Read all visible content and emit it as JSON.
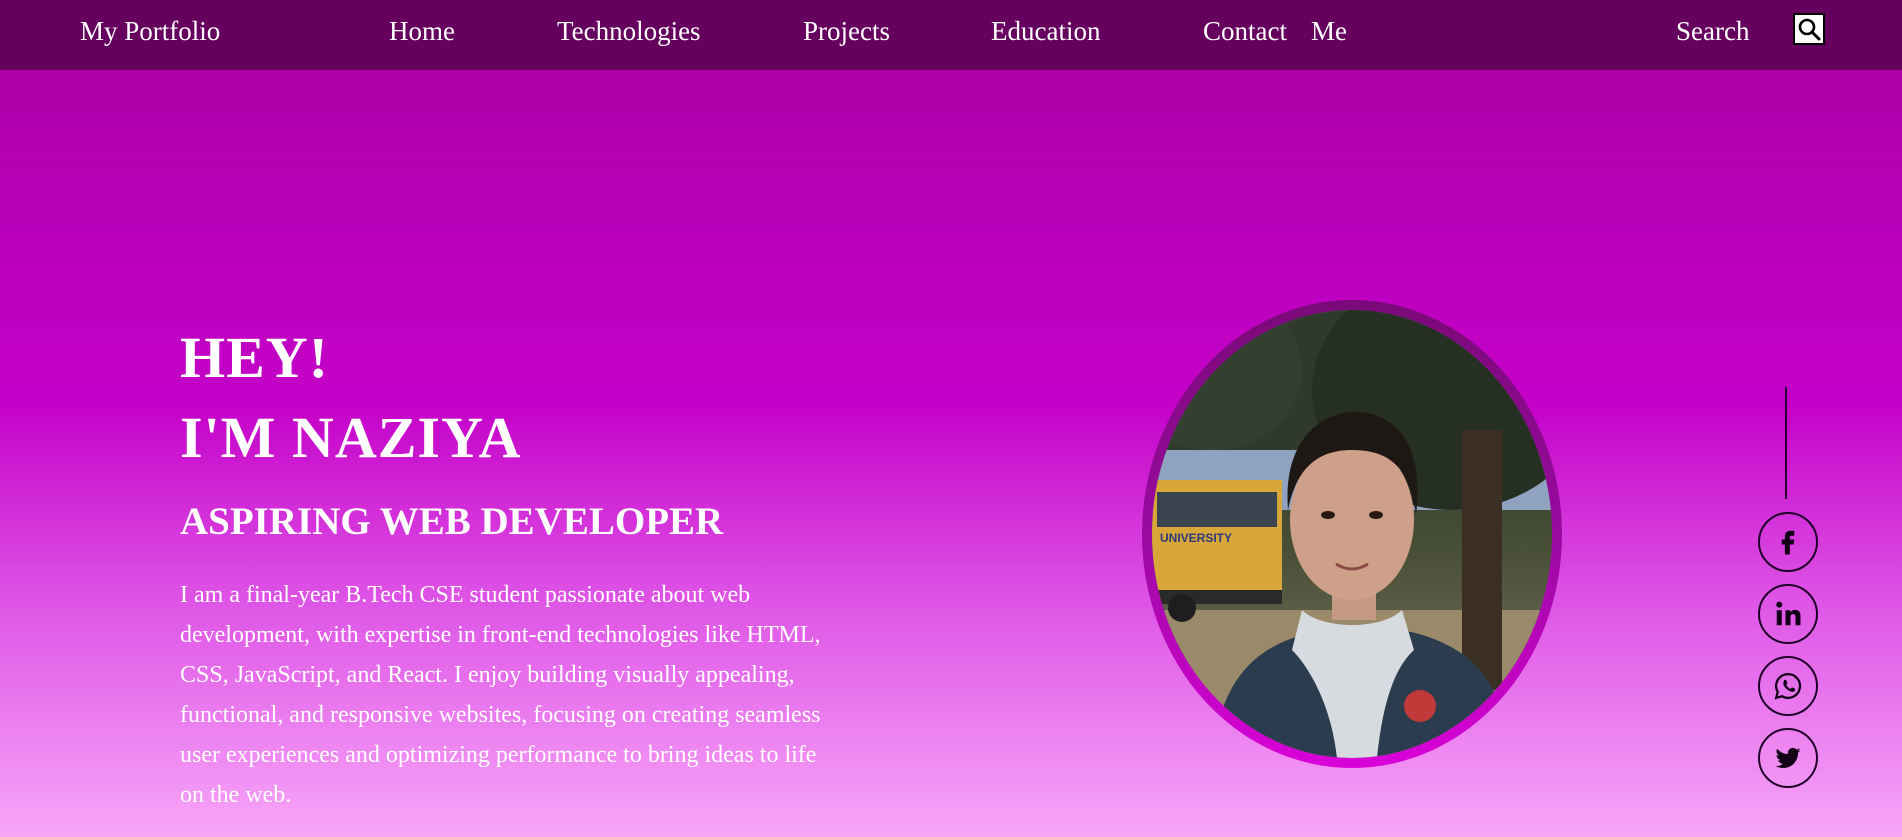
{
  "nav": {
    "brand": "My Portfolio",
    "links": [
      "Home",
      "Technologies",
      "Projects",
      "Education",
      "Contact",
      "Me"
    ],
    "search_label": "Search"
  },
  "hero": {
    "greeting_line1": "HEY!",
    "greeting_line2": "I'M NAZIYA",
    "role": "ASPIRING WEB DEVELOPER",
    "description": "I am a final-year B.Tech CSE student passionate about web development, with expertise in front-end technologies like HTML, CSS, JavaScript, and React. I enjoy building visually appealing, functional, and responsive websites, focusing on creating seamless user experiences and optimizing performance to bring ideas to life on the web."
  },
  "photo": {
    "bus_text": "UNIVERSITY"
  },
  "social": {
    "items": [
      "facebook-icon",
      "linkedin-icon",
      "whatsapp-icon",
      "twitter-icon"
    ]
  },
  "colors": {
    "navbar": "#66005f",
    "hero_top": "#a800a0",
    "hero_mid": "#c400c8",
    "hero_bottom": "#f7a6f8",
    "photo_ring": "#9a0aa0",
    "social_border": "#1e0028"
  }
}
